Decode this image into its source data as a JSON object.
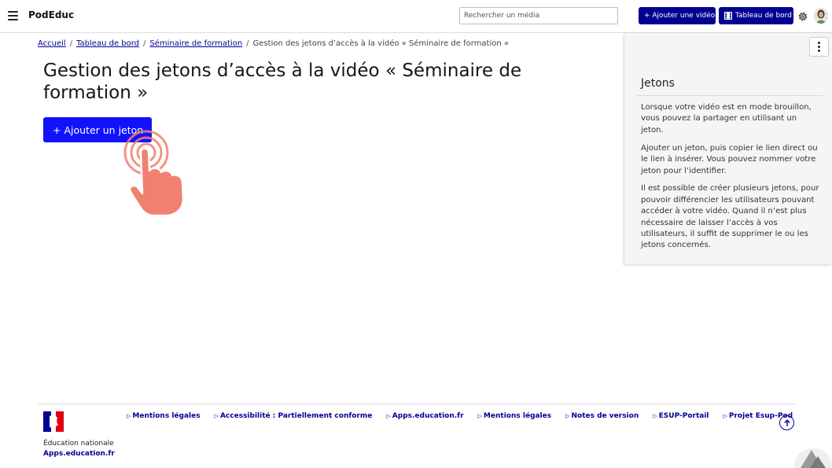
{
  "header": {
    "brand": "PodEduc",
    "search_placeholder": "Rechercher un média",
    "add_video_label": "+ Ajouter une vidéo",
    "dashboard_label": "Tableau de bord"
  },
  "breadcrumb": {
    "items": [
      "Accueil",
      "Tableau de bord",
      "Séminaire de formation"
    ],
    "current": "Gestion des jetons d’accès à la vidéo « Séminaire de formation »"
  },
  "main": {
    "title": "Gestion des jetons d’accès à la vidéo « Séminaire de formation »",
    "add_token_label": "+ Ajouter un jeton"
  },
  "aside": {
    "title": "Jetons",
    "paragraphs": [
      "Lorsque votre vidéo est en mode brouillon, vous pouvez la partager en utilisant un jeton.",
      "Ajouter un jeton, puis copier le lien direct ou le lien à insérer. Vous pouvez nommer votre jeton pour l’identifier.",
      "Il est possible de créer plusieurs jetons, pour pouvoir différencier les utilisateurs pouvant accéder à votre vidéo. Quand il n’est plus nécessaire de laisser l’accès à vos utilisateurs, il suffit de supprimer le ou les jetons concernés."
    ]
  },
  "footer": {
    "org": "Éducation nationale",
    "site": "Apps.education.fr",
    "links": [
      "Mentions légales",
      "Accessibilité : Partiellement conforme",
      "Apps.education.fr",
      "Mentions légales",
      "Notes de version",
      "ESUP-Portail",
      "Projet Esup-Pod"
    ]
  },
  "icons": {
    "menu": "hamburger-icon",
    "search": "search-field",
    "dashboard": "film-icon",
    "settings": "gear-icon",
    "profile": "avatar",
    "more": "kebab-icon",
    "back_to_top": "arrow-up-icon",
    "pointer": "hand-pointer-icon"
  },
  "colors": {
    "navy": "#000091",
    "primary_button": "#1212ff",
    "aside_bg": "#f5f5f5",
    "pointer": "#f08070"
  }
}
